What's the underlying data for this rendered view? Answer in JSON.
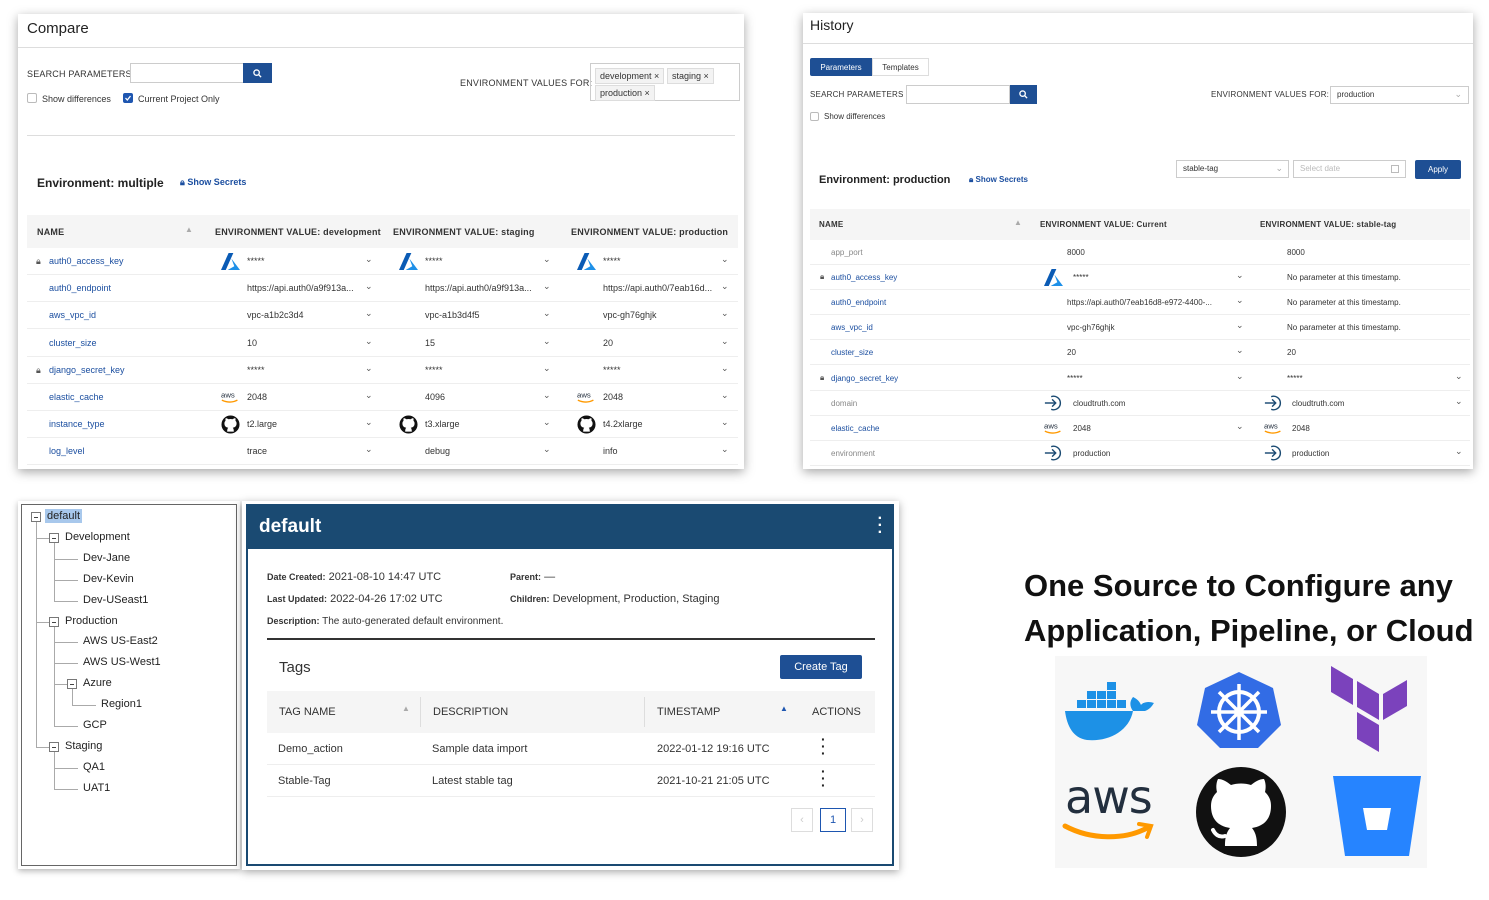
{
  "compare": {
    "title": "Compare",
    "search_label": "SEARCH PARAMETERS :",
    "show_differences": "Show differences",
    "current_project_only": "Current Project Only",
    "env_values_for": "ENVIRONMENT VALUES FOR:",
    "env_tags": [
      "development",
      "staging",
      "production"
    ],
    "environment_heading": "Environment: multiple",
    "show_secrets": "Show Secrets",
    "columns": [
      "NAME",
      "ENVIRONMENT VALUE: development",
      "ENVIRONMENT VALUE: staging",
      "ENVIRONMENT VALUE: production"
    ],
    "rows": [
      {
        "name": "auth0_access_key",
        "secret": true,
        "values": [
          "*****",
          "*****",
          "*****"
        ],
        "icons": [
          "azure-icon",
          "azure-icon",
          "azure-icon"
        ]
      },
      {
        "name": "auth0_endpoint",
        "secret": false,
        "values": [
          "https://api.auth0/a9f913a...",
          "https://api.auth0/a9f913a...",
          "https://api.auth0/7eab16d..."
        ],
        "icons": [
          "",
          "",
          ""
        ]
      },
      {
        "name": "aws_vpc_id",
        "secret": false,
        "values": [
          "vpc-a1b2c3d4",
          "vpc-a1b3d4f5",
          "vpc-gh76ghjk"
        ],
        "icons": [
          "",
          "",
          ""
        ]
      },
      {
        "name": "cluster_size",
        "secret": false,
        "values": [
          "10",
          "15",
          "20"
        ],
        "icons": [
          "",
          "",
          ""
        ]
      },
      {
        "name": "django_secret_key",
        "secret": true,
        "values": [
          "*****",
          "*****",
          "*****"
        ],
        "icons": [
          "",
          "",
          ""
        ]
      },
      {
        "name": "elastic_cache",
        "secret": false,
        "values": [
          "2048",
          "4096",
          "2048"
        ],
        "icons": [
          "aws-icon",
          "",
          "aws-icon"
        ]
      },
      {
        "name": "instance_type",
        "secret": false,
        "values": [
          "t2.large",
          "t3.xlarge",
          "t4.2xlarge"
        ],
        "icons": [
          "github-icon",
          "github-icon",
          "github-icon"
        ]
      },
      {
        "name": "log_level",
        "secret": false,
        "values": [
          "trace",
          "debug",
          "info"
        ],
        "icons": [
          "",
          "",
          ""
        ]
      }
    ]
  },
  "history": {
    "title": "History",
    "tabs": [
      "Parameters",
      "Templates"
    ],
    "search_label": "SEARCH PARAMETERS :",
    "show_differences": "Show differences",
    "env_values_for": "ENVIRONMENT VALUES FOR:",
    "env_selected": "production",
    "environment_heading": "Environment: production",
    "show_secrets": "Show Secrets",
    "tag_selected": "stable-tag",
    "date_placeholder": "Select date",
    "apply": "Apply",
    "columns": [
      "NAME",
      "ENVIRONMENT VALUE: Current",
      "ENVIRONMENT VALUE: stable-tag"
    ],
    "rows": [
      {
        "name": "app_port",
        "link": false,
        "secret": false,
        "current": "8000",
        "current_icon": "",
        "tag": "8000",
        "tag_icon": "",
        "chev1": false,
        "chev2": false
      },
      {
        "name": "auth0_access_key",
        "link": true,
        "secret": true,
        "current": "*****",
        "current_icon": "azure-icon",
        "tag": "No parameter at this timestamp.",
        "tag_icon": "",
        "chev1": true,
        "chev2": false
      },
      {
        "name": "auth0_endpoint",
        "link": true,
        "secret": false,
        "current": "https://api.auth0/7eab16d8-e972-4400-...",
        "current_icon": "",
        "tag": "No parameter at this timestamp.",
        "tag_icon": "",
        "chev1": true,
        "chev2": false
      },
      {
        "name": "aws_vpc_id",
        "link": true,
        "secret": false,
        "current": "vpc-gh76ghjk",
        "current_icon": "",
        "tag": "No parameter at this timestamp.",
        "tag_icon": "",
        "chev1": true,
        "chev2": false
      },
      {
        "name": "cluster_size",
        "link": true,
        "secret": false,
        "current": "20",
        "current_icon": "",
        "tag": "20",
        "tag_icon": "",
        "chev1": true,
        "chev2": false
      },
      {
        "name": "django_secret_key",
        "link": true,
        "secret": true,
        "current": "*****",
        "current_icon": "",
        "tag": "*****",
        "tag_icon": "",
        "chev1": true,
        "chev2": true
      },
      {
        "name": "domain",
        "link": false,
        "secret": false,
        "current": "cloudtruth.com",
        "current_icon": "arrow-in-icon",
        "tag": "cloudtruth.com",
        "tag_icon": "arrow-in-icon",
        "chev1": false,
        "chev2": true
      },
      {
        "name": "elastic_cache",
        "link": true,
        "secret": false,
        "current": "2048",
        "current_icon": "aws-icon",
        "tag": "2048",
        "tag_icon": "aws-icon",
        "chev1": true,
        "chev2": false
      },
      {
        "name": "environment",
        "link": false,
        "secret": false,
        "current": "production",
        "current_icon": "arrow-in-icon",
        "tag": "production",
        "tag_icon": "arrow-in-icon",
        "chev1": false,
        "chev2": true
      }
    ]
  },
  "tree": {
    "root": "default",
    "nodes": [
      {
        "label": "Development",
        "depth": 1,
        "expandable": true
      },
      {
        "label": "Dev-Jane",
        "depth": 2,
        "expandable": false
      },
      {
        "label": "Dev-Kevin",
        "depth": 2,
        "expandable": false
      },
      {
        "label": "Dev-USeast1",
        "depth": 2,
        "expandable": false
      },
      {
        "label": "Production",
        "depth": 1,
        "expandable": true
      },
      {
        "label": "AWS US-East2",
        "depth": 2,
        "expandable": false
      },
      {
        "label": "AWS US-West1",
        "depth": 2,
        "expandable": false
      },
      {
        "label": "Azure",
        "depth": 2,
        "expandable": true
      },
      {
        "label": "Region1",
        "depth": 3,
        "expandable": false
      },
      {
        "label": "GCP",
        "depth": 2,
        "expandable": false
      },
      {
        "label": "Staging",
        "depth": 1,
        "expandable": true
      },
      {
        "label": "QA1",
        "depth": 2,
        "expandable": false
      },
      {
        "label": "UAT1",
        "depth": 2,
        "expandable": false
      }
    ]
  },
  "detail": {
    "title": "default",
    "date_created_label": "Date Created:",
    "date_created": "2021-08-10 14:47 UTC",
    "last_updated_label": "Last Updated:",
    "last_updated": "2022-04-26 17:02 UTC",
    "description_label": "Description:",
    "description": "The auto-generated default environment.",
    "parent_label": "Parent:",
    "parent": "—",
    "children_label": "Children:",
    "children": "Development, Production, Staging",
    "tags_heading": "Tags",
    "create_tag": "Create Tag",
    "columns": [
      "TAG NAME",
      "DESCRIPTION",
      "TIMESTAMP",
      "ACTIONS"
    ],
    "rows": [
      {
        "name": "Demo_action",
        "description": "Sample data import",
        "timestamp": "2022-01-12 19:16 UTC"
      },
      {
        "name": "Stable-Tag",
        "description": "Latest stable tag",
        "timestamp": "2021-10-21 21:05 UTC"
      }
    ],
    "page": "1"
  },
  "promo": {
    "line1": "One Source to Configure any",
    "line2": "Application, Pipeline, or Cloud",
    "logos": [
      "docker-icon",
      "kubernetes-icon",
      "terraform-icon",
      "aws-icon",
      "github-icon",
      "bitbucket-icon"
    ],
    "aws_text": "aws"
  },
  "colors": {
    "accent": "#1e4f94",
    "header_bar": "#1a4a72",
    "link": "#1c4fa0"
  }
}
